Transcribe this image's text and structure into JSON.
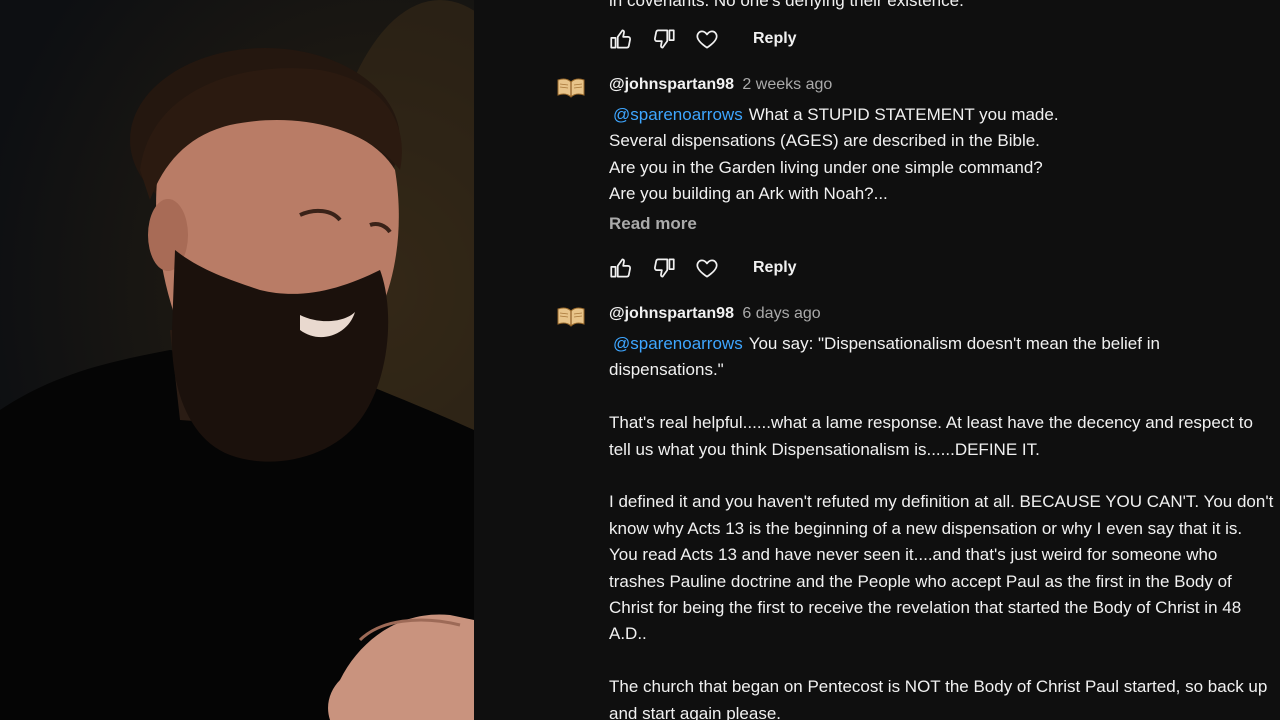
{
  "webcam": {
    "icon": "person-on-camera"
  },
  "comments_panel": {
    "cut_off_text": "in covenants. No one's denying their existence.",
    "action_bar_1": {
      "like_icon": "thumbs-up-icon",
      "dislike_icon": "thumbs-down-icon",
      "heart_icon": "heart-icon",
      "reply_label": "Reply"
    },
    "comment_1": {
      "avatar_icon": "open-book-icon",
      "author": "@johnspartan98",
      "time": "2 weeks ago",
      "mention": "@sparenoarrows",
      "lines": [
        "What a STUPID STATEMENT you made.",
        "Several dispensations (AGES) are described in the Bible.",
        "Are you in the Garden living under one simple command?",
        "Are you building an Ark with Noah?..."
      ],
      "read_more": "Read more",
      "reply_label": "Reply"
    },
    "comment_2": {
      "avatar_icon": "open-book-icon",
      "author": "@johnspartan98",
      "time": "6 days ago",
      "mention": "@sparenoarrows",
      "p1_rest": "You say: \"Dispensationalism doesn't mean the belief in dispensations.\"",
      "p2": "That's real helpful......what a lame response. At least have the decency and respect to tell us what you think Dispensationalism is......DEFINE IT.",
      "p3": "I defined it and you haven't refuted my definition at all. BECAUSE YOU CAN'T. You don't know why Acts 13 is the beginning of a new dispensation or why I even say that it is. You read Acts 13 and have never seen it....and that's just weird for someone who trashes Pauline doctrine and the People who accept Paul as the first in the Body of Christ for being the first to receive the revelation that started the Body of Christ in 48 A.D..",
      "p4": "The church that began on Pentecost is NOT the Body of Christ Paul started, so back up and start again please."
    }
  }
}
